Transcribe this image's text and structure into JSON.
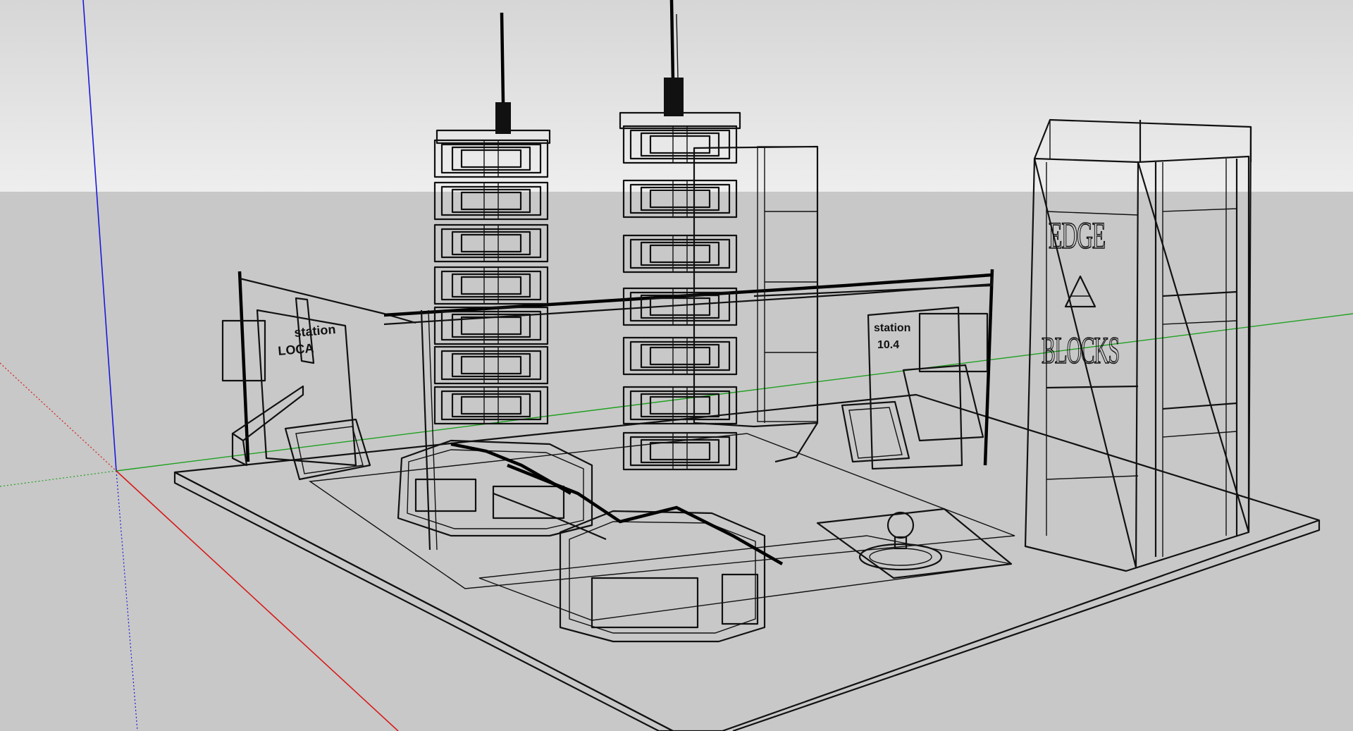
{
  "viewport": {
    "description_axes": {
      "blue_axis_color": "#1a1ad8",
      "green_axis_color": "#1fa01f",
      "red_axis_color": "#d81a1a"
    },
    "sky_color": "#e6e6e6",
    "ground_color": "#c8c8c8"
  },
  "model": {
    "billboard": {
      "line1": "EDGE",
      "line2": "BLOCKS"
    },
    "left_kiosk_sign": {
      "line1": "station",
      "line2": "LOCA"
    },
    "right_kiosk_sign": {
      "line1": "station",
      "line2": "10.4"
    },
    "icons": [
      "lightbulb-icon",
      "a-triangle-icon"
    ]
  }
}
